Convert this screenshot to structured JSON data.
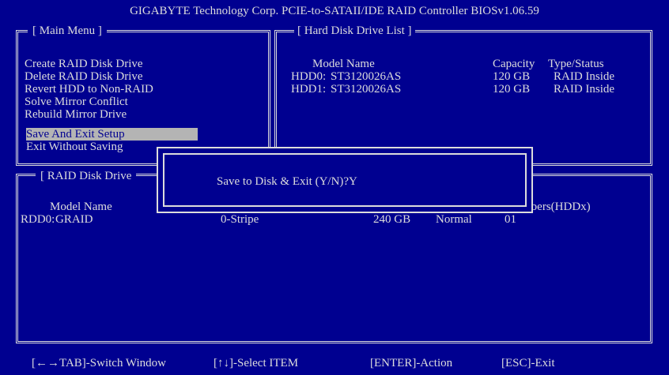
{
  "title": "GIGABYTE Technology Corp. PCIE-to-SATAII/IDE RAID Controller BIOSv1.06.59",
  "main_menu": {
    "title": "[ Main Menu ]",
    "items": [
      "Create RAID Disk Drive",
      "Delete RAID Disk Drive",
      "Revert HDD to Non-RAID",
      "Solve Mirror Conflict",
      "Rebuild Mirror Drive",
      "Save And Exit Setup",
      "Exit Without Saving"
    ],
    "selected": "Save And Exit Setup"
  },
  "hdd_list": {
    "title": "[ Hard Disk Drive List ]",
    "headers": {
      "model": "Model Name",
      "capacity": "Capacity",
      "type": "Type/Status"
    },
    "rows": [
      {
        "id": "HDD0:",
        "model": "ST3120026AS",
        "capacity": "120 GB",
        "type": "RAID Inside"
      },
      {
        "id": "HDD1:",
        "model": "ST3120026AS",
        "capacity": "120 GB",
        "type": "RAID Inside"
      }
    ]
  },
  "raid_list": {
    "title": "[ RAID Disk Drive",
    "headers": {
      "model": "Model Name",
      "members": "mbers(HDDx)"
    },
    "rows": [
      {
        "id": "RDD0:",
        "model": "GRAID",
        "level": "0-Stripe",
        "capacity": "240 GB",
        "status": "Normal",
        "members": "01"
      }
    ]
  },
  "dialog": {
    "prompt": "Save to Disk & Exit (Y/N)?Y"
  },
  "statusbar": {
    "switch": "[←→TAB]-Switch Window",
    "select": "[↑↓]-Select ITEM",
    "action": "[ENTER]-Action",
    "exit": "[ESC]-Exit"
  }
}
